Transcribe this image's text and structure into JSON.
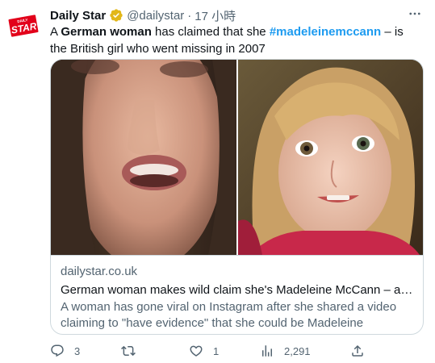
{
  "tweet": {
    "author": {
      "display_name": "Daily Star",
      "handle": "@dailystar",
      "avatar_text_top": "DAILY",
      "avatar_text_main": "STAR"
    },
    "separator": "·",
    "time": "17 小時",
    "text": {
      "part1": "A ",
      "bold": "German woman",
      "part2": " has claimed that she ",
      "hashtag": "#madeleinemccann",
      "part3": " – is the British girl who went missing in 2007"
    },
    "card": {
      "domain": "dailystar.co.uk",
      "title": "German woman makes wild claim she's Madeleine McCann – and sh...",
      "description": "A woman has gone viral on Instagram after she shared a video claiming to \"have evidence\" that she could be Madeleine McCann, ..."
    },
    "actions": {
      "replies": "3",
      "retweets": "",
      "likes": "1",
      "views": "2,291"
    }
  },
  "colors": {
    "accent": "#1d9bf0",
    "secondary_text": "#536471",
    "border": "#cfd9de",
    "brand_red": "#e2001a",
    "verified_gold": "#e2b719"
  }
}
